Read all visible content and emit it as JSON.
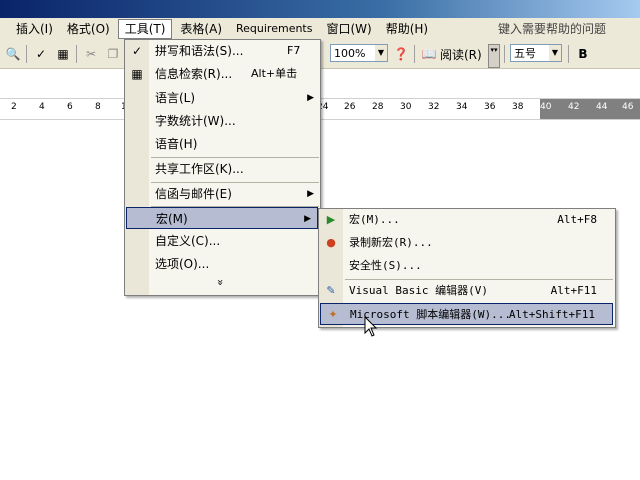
{
  "menubar": {
    "items": [
      {
        "label": "插入(I)"
      },
      {
        "label": "格式(O)"
      },
      {
        "label": "工具(T)"
      },
      {
        "label": "表格(A)"
      },
      {
        "label": "Requirements"
      },
      {
        "label": "窗口(W)"
      },
      {
        "label": "帮助(H)"
      }
    ],
    "help_box": "键入需要帮助的问题"
  },
  "toolbar": {
    "zoom": "100%",
    "read_label": "阅读(R)",
    "font_size": "五号",
    "bold": "B"
  },
  "ruler": {
    "ticks": [
      "2",
      "4",
      "6",
      "8",
      "1",
      "24",
      "26",
      "28",
      "30",
      "32",
      "34",
      "36",
      "38",
      "40",
      "42",
      "44",
      "46"
    ]
  },
  "tools_menu": {
    "items": [
      {
        "label": "拼写和语法(S)...",
        "shortcut": "F7",
        "icon": "spell-check-icon"
      },
      {
        "label": "信息检索(R)...",
        "shortcut": "Alt+单击",
        "icon": "research-icon"
      },
      {
        "label": "语言(L)",
        "submenu": true
      },
      {
        "label": "字数统计(W)..."
      },
      {
        "label": "语音(H)"
      },
      {
        "label": "共享工作区(K)..."
      },
      {
        "label": "信函与邮件(E)",
        "submenu": true
      },
      {
        "label": "宏(M)",
        "submenu": true,
        "highlighted": true
      },
      {
        "label": "自定义(C)..."
      },
      {
        "label": "选项(O)..."
      }
    ],
    "more": "»"
  },
  "macro_submenu": {
    "items": [
      {
        "label": "宏(M)...",
        "shortcut": "Alt+F8",
        "icon": "play-icon"
      },
      {
        "label": "录制新宏(R)...",
        "icon": "record-icon"
      },
      {
        "label": "安全性(S)..."
      },
      {
        "label": "Visual Basic 编辑器(V)",
        "shortcut": "Alt+F11",
        "icon": "vb-editor-icon"
      },
      {
        "label": "Microsoft 脚本编辑器(W)...",
        "shortcut": "Alt+Shift+F11",
        "icon": "script-editor-icon",
        "highlighted": true
      }
    ]
  }
}
